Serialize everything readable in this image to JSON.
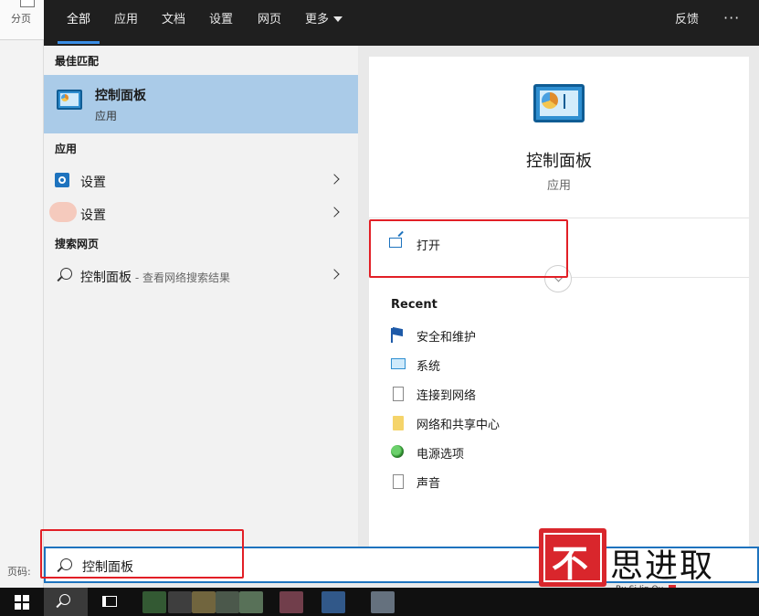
{
  "background_app": {
    "tab_label": "分页",
    "status_label": "页码:"
  },
  "tabs": [
    {
      "label": "全部"
    },
    {
      "label": "应用"
    },
    {
      "label": "文档"
    },
    {
      "label": "设置"
    },
    {
      "label": "网页"
    },
    {
      "label": "更多"
    }
  ],
  "topbar": {
    "feedback_label": "反馈",
    "more_label": "···"
  },
  "best_match": {
    "header": "最佳匹配",
    "title": "控制面板",
    "subtitle": "应用",
    "icon": "control-panel-icon"
  },
  "apps": {
    "header": "应用",
    "items": [
      {
        "label": "设置",
        "icon": "gear-icon"
      },
      {
        "label": "设置",
        "icon": "blurred-app-icon"
      }
    ]
  },
  "web": {
    "header": "搜索网页",
    "query": "控制面板",
    "suffix": " - 查看网络搜索结果"
  },
  "details": {
    "title": "控制面板",
    "subtitle": "应用",
    "open_label": "打开",
    "recent_header": "Recent",
    "recent_items": [
      {
        "label": "安全和维护",
        "icon": "flag-icon"
      },
      {
        "label": "系统",
        "icon": "monitor-icon"
      },
      {
        "label": "连接到网络",
        "icon": "document-icon"
      },
      {
        "label": "网络和共享中心",
        "icon": "folder-icon"
      },
      {
        "label": "电源选项",
        "icon": "power-icon"
      },
      {
        "label": "声音",
        "icon": "document-icon"
      }
    ]
  },
  "search": {
    "value": "控制面板"
  },
  "watermark": {
    "seal_char": "不",
    "text": "思进取",
    "pinyin": "Bu Si Jin Qu"
  },
  "colors": {
    "accent": "#1e73be",
    "selection": "#aacbe8",
    "highlight_box": "#e21f26",
    "topbar": "#1f1f1f",
    "taskbar": "#101010"
  }
}
